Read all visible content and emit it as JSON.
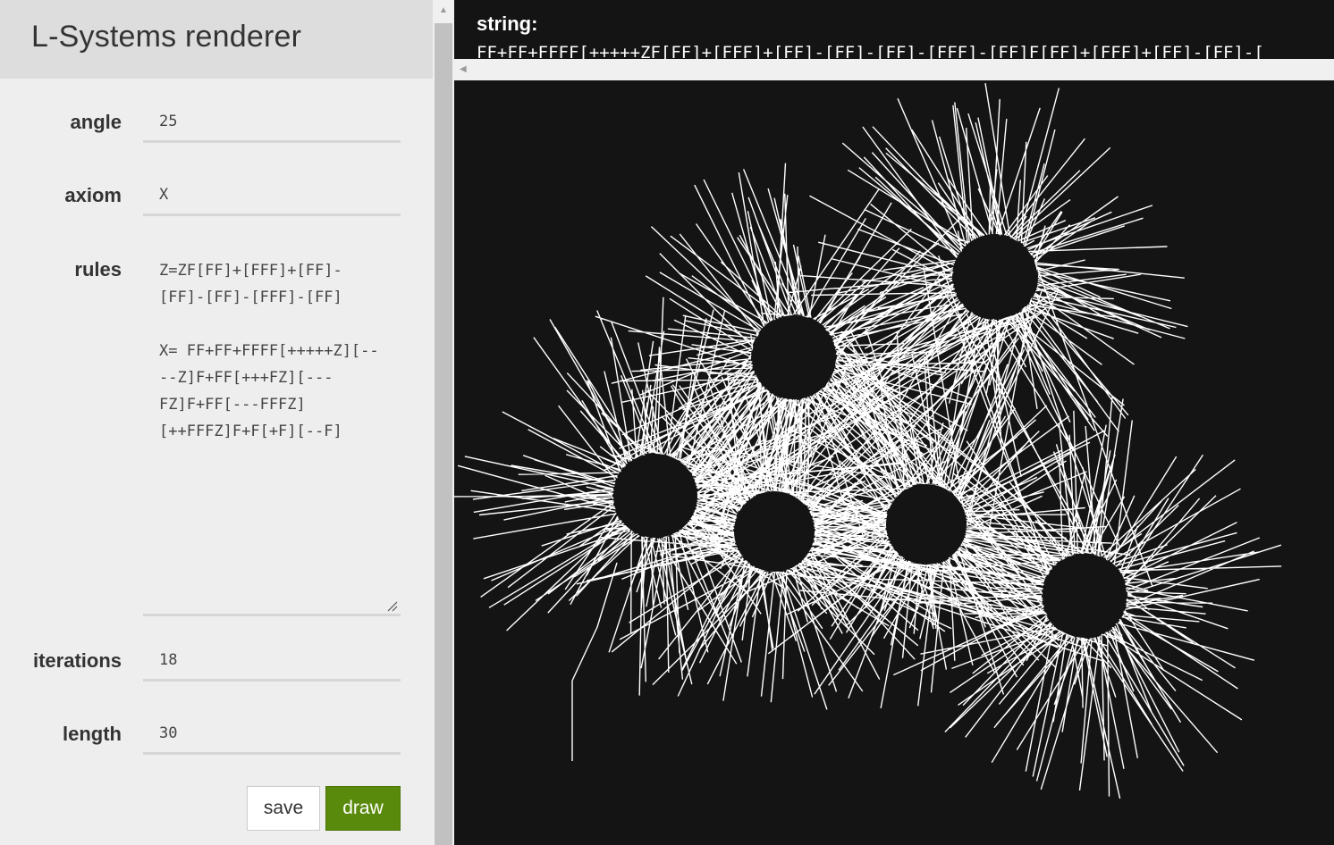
{
  "app": {
    "title": "L-Systems renderer"
  },
  "form": {
    "angle": {
      "label": "angle",
      "value": "25"
    },
    "axiom": {
      "label": "axiom",
      "value": "X"
    },
    "rules": {
      "label": "rules",
      "value": "Z=ZF[FF]+[FFF]+[FF]-[FF]-[FF]-[FFF]-[FF]\n\nX= FF+FF+FFFF[+++++Z][----Z]F+FF[+++FZ][---FZ]F+FF[---FFFZ][++FFFZ]F+F[+F][--F]"
    },
    "iterations": {
      "label": "iterations",
      "value": "18"
    },
    "length": {
      "label": "length",
      "value": "30"
    }
  },
  "buttons": {
    "save": "save",
    "draw": "draw"
  },
  "output": {
    "string_label": "string:",
    "string_value": "FF+FF+FFFF[+++++ZF[FF]+[FFF]+[FF]-[FF]-[FF]-[FFF]-[FF]F[FF]+[FFF]+[FF]-[FF]-["
  },
  "icons": {
    "scroll_up": "scroll-up-arrow-icon",
    "scroll_left": "scroll-left-arrow-icon",
    "resize": "resize-grip-icon"
  },
  "colors": {
    "draw_button": "#5a8a0c",
    "canvas_bg": "#141414",
    "stroke": "#ffffff"
  }
}
